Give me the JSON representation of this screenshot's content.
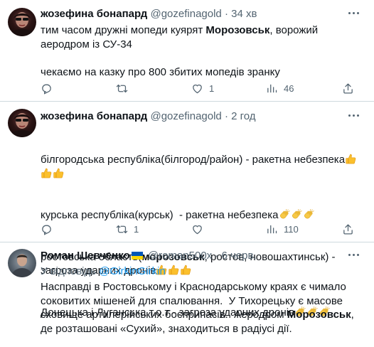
{
  "tweets": [
    {
      "name": "жозефина бонапард",
      "handle": "@gozefinagold",
      "separator": "·",
      "time": "34 хв",
      "text": {
        "t1": "тим часом дружні мопеди куярят ",
        "b1": "Морозовськ",
        "t2": ", ворожий аеродром із СУ-34",
        "t3": "чекаємо на казку про 800 збитих мопедів зранку"
      },
      "actions": {
        "replies": "",
        "retweets": "",
        "likes": "1",
        "views": "46"
      }
    },
    {
      "name": "жозефина бонапард",
      "handle": "@gozefinagold",
      "separator": "·",
      "time": "2 год",
      "text": {
        "l1": "білгородська республіка(білгород/район) - ракетна небезпека",
        "l2": "курська республіка(курськ)  - ракетна небезпека",
        "l3a": "ростовська область(",
        "l3b": "морозовськ",
        "l3c": ", ростов, новошахтинськ) - загроза ударних дронів",
        "l4": "Донецька і Луганська т.о.т - загроза ударних дронів"
      },
      "actions": {
        "replies": "",
        "retweets": "1",
        "likes": "",
        "views": "110"
      }
    },
    {
      "name": "Роман Шевченко",
      "handle": "@roman500x",
      "separator": "·",
      "time": "6 черв.",
      "reply_to_label": "У відповідь",
      "reply_to_handle": "@GirkinGirkin",
      "text": {
        "t1": "Насправді в Ростовському і Краснодарському краях є чимало соковитих мішеней для спалювання.  У Тихорецьку є масове сховище артилерійських боєприпасів.  Аеродром ",
        "b1": "Морозовськ",
        "t2": ", де розташовані «Сухий», знаходиться в радіусі дії."
      },
      "flag_colors": {
        "top": "#0057b7",
        "bottom": "#ffd700"
      }
    }
  ],
  "colors": {
    "text": "#0f1419",
    "muted": "#536471",
    "link": "#1d9bf0",
    "border": "#cfd9de"
  },
  "icons": [
    "reply-icon",
    "retweet-icon",
    "like-icon",
    "views-icon",
    "share-icon",
    "more-icon",
    "thumbs-up-emoji",
    "clapping-hands-emoji",
    "ukraine-flag"
  ]
}
